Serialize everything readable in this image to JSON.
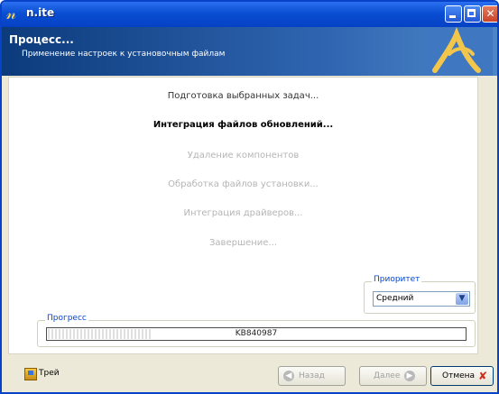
{
  "window": {
    "title": "n.ite"
  },
  "banner": {
    "title": "Процесс...",
    "subtitle": "Применение настроек к установочным файлам"
  },
  "tasks": [
    {
      "label": "Подготовка выбранных задач...",
      "state": "done"
    },
    {
      "label": "Интеграция файлов обновлений...",
      "state": "current"
    },
    {
      "label": "Удаление компонентов",
      "state": "pending"
    },
    {
      "label": "Обработка файлов установки...",
      "state": "pending"
    },
    {
      "label": "Интеграция драйверов...",
      "state": "pending"
    },
    {
      "label": "Завершение...",
      "state": "pending"
    }
  ],
  "priority": {
    "label": "Приоритет",
    "value": "Средний"
  },
  "progress": {
    "label": "Прогресс",
    "text": "KB840987",
    "fraction": 0.25
  },
  "footer": {
    "tray_label": "Трей",
    "back_label": "Назад",
    "next_label": "Далее",
    "cancel_label": "Отмена"
  },
  "colors": {
    "title_bar": "#0a4ed3",
    "banner": "#2f65b0",
    "group_label": "#0046d5",
    "pending_text": "#b5b5b5"
  },
  "icons": {
    "app": "n-logo-icon",
    "minimize": "minimize-icon",
    "maximize": "maximize-icon",
    "close": "close-icon",
    "tray": "tray-icon",
    "back": "back-arrow-icon",
    "next": "next-arrow-icon",
    "cancel": "cancel-x-icon",
    "dropdown": "chevron-down-icon"
  }
}
